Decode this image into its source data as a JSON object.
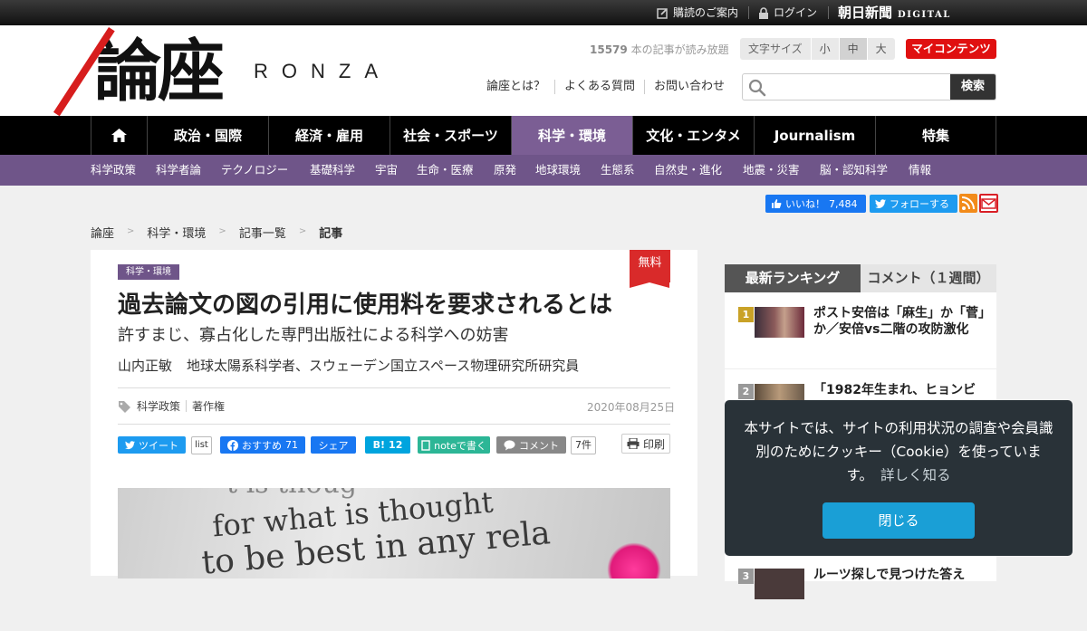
{
  "topbar": {
    "guide": "購読のご案内",
    "login": "ログイン",
    "brand": "朝日新聞",
    "brand_sub": "DIGITAL"
  },
  "header": {
    "logo_kanji": "論座",
    "logo_latin": "RONZA",
    "article_count_number": "15579",
    "article_count_text": " 本の記事が読み放題",
    "font_size_label": "文字サイズ",
    "font_sizes": [
      "小",
      "中",
      "大"
    ],
    "font_size_selected": "中",
    "my_content": "マイコンテンツ",
    "links": [
      "論座とは？",
      "よくある質問",
      "お問い合わせ"
    ],
    "search_placeholder": "",
    "search_button": "検索"
  },
  "nav": {
    "items": [
      "政治・国際",
      "経済・雇用",
      "社会・スポーツ",
      "科学・環境",
      "文化・エンタメ",
      "Journalism",
      "特集"
    ],
    "active": "科学・環境"
  },
  "subnav": {
    "items": [
      "科学政策",
      "科学者論",
      "テクノロジー",
      "基礎科学",
      "宇宙",
      "生命・医療",
      "原発",
      "地球環境",
      "生態系",
      "自然史・進化",
      "地震・災害",
      "脳・認知科学",
      "情報"
    ]
  },
  "social_top": {
    "like_label": "いいね！",
    "like_count": "7,484",
    "follow_label": "フォローする"
  },
  "breadcrumb": [
    "論座",
    "科学・環境",
    "記事一覧",
    "記事"
  ],
  "article": {
    "free_label": "無料",
    "category": "科学・環境",
    "title": "過去論文の図の引用に使用料を要求されるとは",
    "subtitle": "許すまじ、寡占化した専門出版社による科学への妨害",
    "author_name": "山内正敏",
    "author_role": "地球太陽系科学者、スウェーデン国立スペース物理研究所研究員",
    "tags": [
      "科学政策",
      "著作権"
    ],
    "date": "2020年08月25日",
    "share": {
      "tweet": "ツイート",
      "list": "list",
      "fb_recommend": "おすすめ",
      "fb_count": "71",
      "fb_share": "シェア",
      "hatena": "B!",
      "hatena_count": "12",
      "note": "noteで書く",
      "comment": "コメント",
      "comment_count": "7件",
      "print": "印刷"
    },
    "photo_text_0": "t is thoug",
    "photo_text_1": "for what is thought",
    "photo_text_2": "to be best in any rela"
  },
  "sidebar": {
    "tab_ranking": "最新ランキング",
    "tab_comment": "コメント（１週間）",
    "ranking": [
      {
        "rank": "1",
        "title": "ポスト安倍は「麻生」か「菅」か／安倍vs二階の攻防激化"
      },
      {
        "rank": "2",
        "title": "「1982年生まれ、ヒョンビ"
      },
      {
        "rank": "3",
        "title": "ルーツ探しで見つけた答え"
      }
    ]
  },
  "cookie": {
    "text": "本サイトでは、サイトの利用状況の調査や会員識別のためにクッキー（Cookie）を使っています。",
    "more": "詳しく知る",
    "close": "閉じる"
  },
  "colors": {
    "purple": "#6f5589",
    "red": "#e01010",
    "dark": "#293238",
    "blue": "#1a9fd6"
  }
}
